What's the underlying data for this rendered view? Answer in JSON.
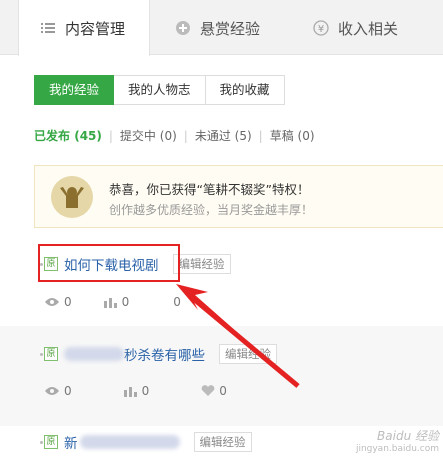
{
  "tabs": [
    {
      "label": "内容管理",
      "icon": "list-icon"
    },
    {
      "label": "悬赏经验",
      "icon": "reward-icon"
    },
    {
      "label": "收入相关",
      "icon": "yen-icon"
    }
  ],
  "subtabs": [
    "我的经验",
    "我的人物志",
    "我的收藏"
  ],
  "filters": [
    {
      "label": "已发布",
      "count": "(45)"
    },
    {
      "label": "提交中",
      "count": "(0)"
    },
    {
      "label": "未通过",
      "count": "(5)"
    },
    {
      "label": "草稿",
      "count": "(0)"
    }
  ],
  "notice": {
    "line1": "恭喜，你已获得“笔耕不辍奖”特权！",
    "line2": "创作越多优质经验，当月奖金越丰厚！",
    "badge_icon": "trophy-person-icon"
  },
  "items": [
    {
      "tag": "原",
      "title": "如何下载电视剧",
      "edit": "编辑经验",
      "views": "0",
      "votes": "0",
      "likes": "0"
    },
    {
      "tag": "原",
      "title": "秒杀卷有哪些",
      "edit": "编辑经验",
      "views": "0",
      "votes": "0",
      "likes": "0"
    },
    {
      "tag": "原",
      "title": "新",
      "edit": "编辑经验"
    }
  ],
  "watermark": {
    "line1": "Baidu 经验",
    "line2": "jingyan.baidu.com"
  },
  "colors": {
    "accent": "#36a745",
    "link": "#2a62a8",
    "highlight": "#e52222"
  }
}
